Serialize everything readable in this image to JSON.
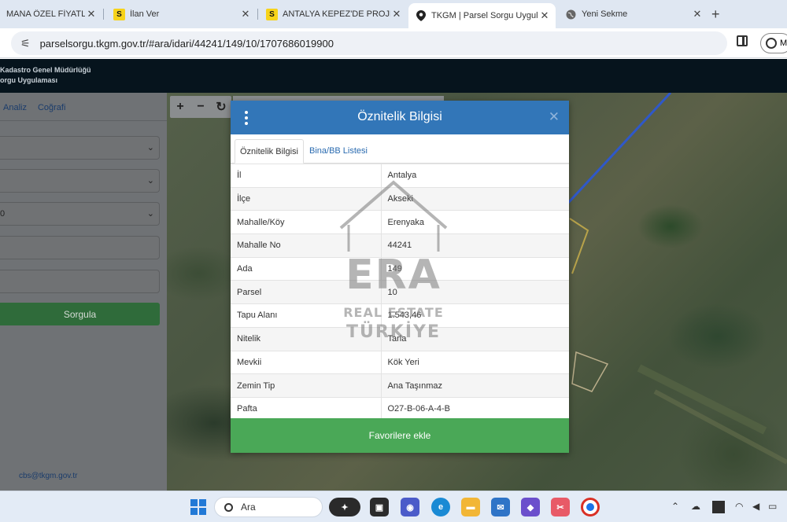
{
  "browser": {
    "tabs": [
      {
        "title": "MANA ÖZEL FİYATLAR",
        "favicon": "",
        "active": false
      },
      {
        "title": "İlan Ver",
        "favicon": "S",
        "active": false
      },
      {
        "title": "ANTALYA KEPEZ'DE PROJEDE",
        "favicon": "S",
        "active": false
      },
      {
        "title": "TKGM | Parsel Sorgu Uygulan",
        "favicon": "location-pin",
        "active": true
      },
      {
        "title": "Yeni Sekme",
        "favicon": "globe",
        "active": false
      }
    ],
    "new_tab": "+",
    "url": "parselsorgu.tkgm.gov.tr/#ara/idari/44241/149/10/1707686019900",
    "profile_letter": "M"
  },
  "app": {
    "header_line1": "Kadastro Genel Müdürlüğü",
    "header_line2": "orgu Uygulaması",
    "nav": [
      "Analiz",
      "Coğrafi"
    ],
    "select3_value": "0",
    "search_button": "Sorgula",
    "contact_email": "cbs@tkgm.gov.tr"
  },
  "map_controls": [
    "+",
    "−",
    "↻"
  ],
  "modal": {
    "title": "Öznitelik Bilgisi",
    "tabs": [
      "Öznitelik Bilgisi",
      "Bina/BB Listesi"
    ],
    "rows": [
      {
        "key": "İl",
        "value": "Antalya"
      },
      {
        "key": "İlçe",
        "value": "Akseki"
      },
      {
        "key": "Mahalle/Köy",
        "value": "Erenyaka"
      },
      {
        "key": "Mahalle No",
        "value": "44241"
      },
      {
        "key": "Ada",
        "value": "149"
      },
      {
        "key": "Parsel",
        "value": "10"
      },
      {
        "key": "Tapu Alanı",
        "value": "1.543,46"
      },
      {
        "key": "Nitelik",
        "value": "Tarla"
      },
      {
        "key": "Mevkii",
        "value": "Kök Yeri"
      },
      {
        "key": "Zemin Tip",
        "value": "Ana Taşınmaz"
      },
      {
        "key": "Pafta",
        "value": "O27-B-06-A-4-B"
      }
    ],
    "favorite_button": "Favorilere ekle"
  },
  "watermark": {
    "brand": "ERA",
    "line2": "REAL ESTATE",
    "line3": "TÜRKİYE"
  },
  "taskbar": {
    "search_placeholder": "Ara"
  }
}
